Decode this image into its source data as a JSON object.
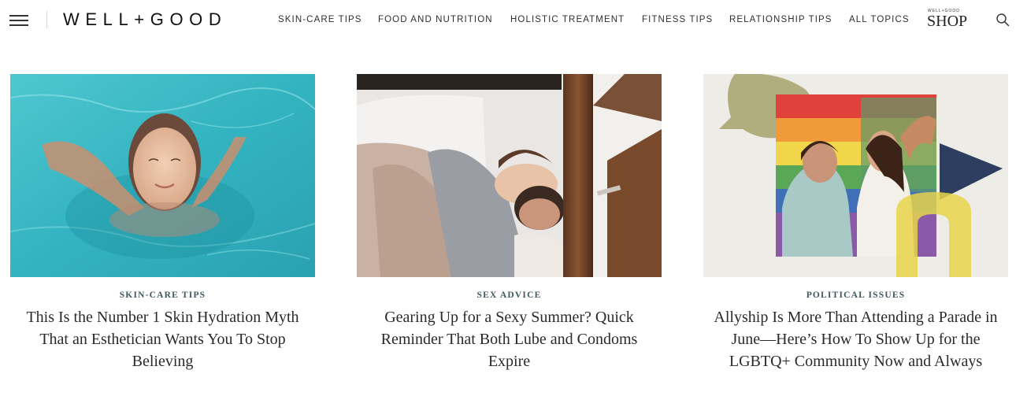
{
  "header": {
    "logo": "WELL+GOOD",
    "nav": [
      {
        "label": "SKIN-CARE TIPS"
      },
      {
        "label": "FOOD AND NUTRITION"
      },
      {
        "label": "HOLISTIC TREATMENT"
      },
      {
        "label": "FITNESS TIPS"
      },
      {
        "label": "RELATIONSHIP TIPS"
      },
      {
        "label": "ALL TOPICS"
      }
    ],
    "shop_small": "WELL+GOOD",
    "shop_big": "SHOP",
    "icons": {
      "menu": "hamburger-menu-icon",
      "search": "search-icon"
    }
  },
  "articles": [
    {
      "category": "SKIN-CARE TIPS",
      "title": "This Is the Number 1 Skin Hydration Myth That an Esthetician Wants You To Stop Believing"
    },
    {
      "category": "SEX ADVICE",
      "title": "Gearing Up for a Sexy Summer? Quick Reminder That Both Lube and Condoms Expire"
    },
    {
      "category": "POLITICAL ISSUES",
      "title": "Allyship Is More Than Attending a Parade in June—Here’s How To Show Up for the LGBTQ+ Community Now and Always"
    }
  ],
  "colors": {
    "category": "#3f5860",
    "title": "#2a2a2a",
    "nav": "#2f2f2f"
  }
}
